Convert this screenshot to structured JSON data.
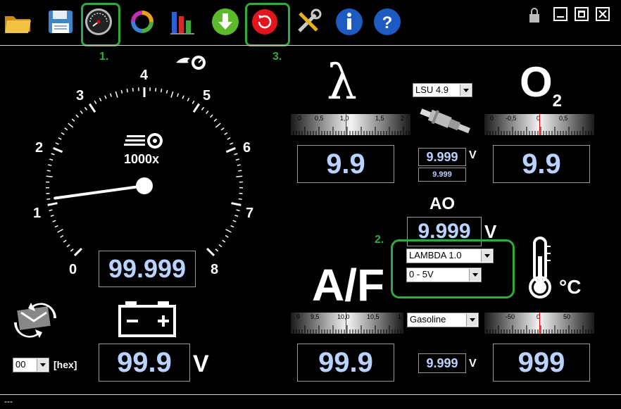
{
  "toolbar": {
    "icons": [
      "folder-open-icon",
      "save-icon",
      "gauge-icon",
      "sync-icon",
      "bar-chart-icon",
      "download-icon",
      "restart-icon",
      "tools-icon",
      "info-icon",
      "help-icon"
    ],
    "step_labels": [
      "1.",
      "3."
    ],
    "highlight_color": "#2eaa3f"
  },
  "gauge": {
    "scale_labels": [
      "0",
      "1",
      "2",
      "3",
      "4",
      "5",
      "6",
      "7",
      "8"
    ],
    "multiplier": "1000x",
    "value": "99.999",
    "needle_value": 1.1
  },
  "lambda_panel": {
    "symbol": "λ",
    "scale_labels": [
      "0",
      "0,5",
      "1,0",
      "1,5",
      "2"
    ],
    "value": "9.9"
  },
  "o2_panel": {
    "symbol": "O",
    "subscript": "2",
    "scale_labels": [
      "0",
      "-0,5",
      "0",
      "0,5"
    ],
    "value": "9.9"
  },
  "sensor": {
    "type_selected": "LSU 4.9",
    "voltage": "9.999",
    "voltage_unit": "V",
    "voltage_small": "9.999"
  },
  "ao": {
    "title": "AO",
    "value": "9.999",
    "unit": "V",
    "step_label": "2.",
    "mode_selected": "LAMBDA 1.0",
    "range_selected": "0 - 5V"
  },
  "af_panel": {
    "label": "A/F",
    "scale_labels": [
      "9",
      "9,5",
      "10,0",
      "10,5",
      "1"
    ],
    "value": "99.9",
    "fuel_selected": "Gasoline",
    "voltage": "9.999",
    "voltage_unit": "V"
  },
  "temp_panel": {
    "unit_label": "°C",
    "scale_labels": [
      "-50",
      "0",
      "50"
    ],
    "value": "999"
  },
  "battery": {
    "value": "99.9",
    "unit": "V",
    "address_selected": "00",
    "address_unit": "[hex]"
  },
  "status_bar": {
    "text": "---"
  }
}
